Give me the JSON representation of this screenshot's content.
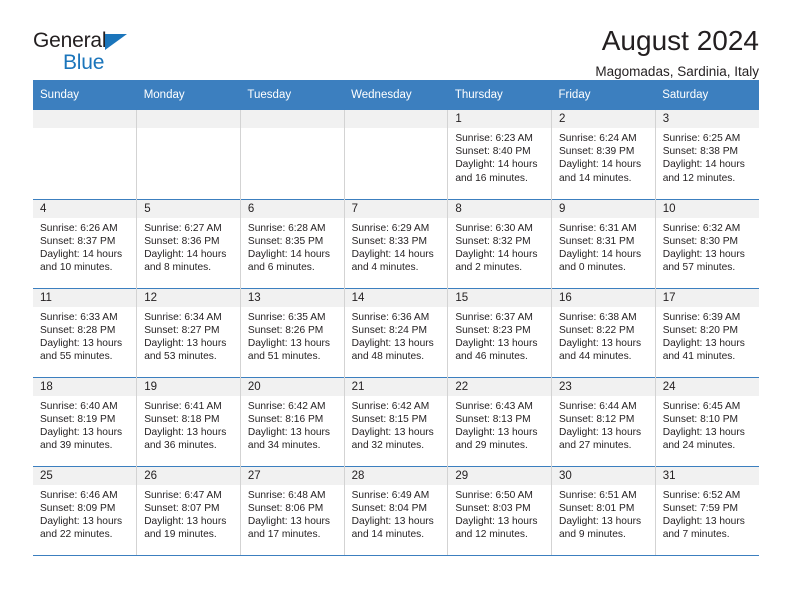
{
  "brand": {
    "name_part1": "General",
    "name_part2": "Blue",
    "triangle_color": "#1b75bb"
  },
  "header": {
    "title": "August 2024",
    "subtitle": "Magomadas, Sardinia, Italy"
  },
  "theme": {
    "header_blue": "#3c7fbf",
    "daynum_band": "#f1f1f1",
    "grid_line": "#d3d3d3",
    "text": "#231f20"
  },
  "weekday_headers": [
    "Sunday",
    "Monday",
    "Tuesday",
    "Wednesday",
    "Thursday",
    "Friday",
    "Saturday"
  ],
  "weeks": [
    [
      {
        "day": "",
        "sunrise": "",
        "sunset": "",
        "daylight_line1": "",
        "daylight_line2": ""
      },
      {
        "day": "",
        "sunrise": "",
        "sunset": "",
        "daylight_line1": "",
        "daylight_line2": ""
      },
      {
        "day": "",
        "sunrise": "",
        "sunset": "",
        "daylight_line1": "",
        "daylight_line2": ""
      },
      {
        "day": "",
        "sunrise": "",
        "sunset": "",
        "daylight_line1": "",
        "daylight_line2": ""
      },
      {
        "day": "1",
        "sunrise": "Sunrise: 6:23 AM",
        "sunset": "Sunset: 8:40 PM",
        "daylight_line1": "Daylight: 14 hours",
        "daylight_line2": "and 16 minutes."
      },
      {
        "day": "2",
        "sunrise": "Sunrise: 6:24 AM",
        "sunset": "Sunset: 8:39 PM",
        "daylight_line1": "Daylight: 14 hours",
        "daylight_line2": "and 14 minutes."
      },
      {
        "day": "3",
        "sunrise": "Sunrise: 6:25 AM",
        "sunset": "Sunset: 8:38 PM",
        "daylight_line1": "Daylight: 14 hours",
        "daylight_line2": "and 12 minutes."
      }
    ],
    [
      {
        "day": "4",
        "sunrise": "Sunrise: 6:26 AM",
        "sunset": "Sunset: 8:37 PM",
        "daylight_line1": "Daylight: 14 hours",
        "daylight_line2": "and 10 minutes."
      },
      {
        "day": "5",
        "sunrise": "Sunrise: 6:27 AM",
        "sunset": "Sunset: 8:36 PM",
        "daylight_line1": "Daylight: 14 hours",
        "daylight_line2": "and 8 minutes."
      },
      {
        "day": "6",
        "sunrise": "Sunrise: 6:28 AM",
        "sunset": "Sunset: 8:35 PM",
        "daylight_line1": "Daylight: 14 hours",
        "daylight_line2": "and 6 minutes."
      },
      {
        "day": "7",
        "sunrise": "Sunrise: 6:29 AM",
        "sunset": "Sunset: 8:33 PM",
        "daylight_line1": "Daylight: 14 hours",
        "daylight_line2": "and 4 minutes."
      },
      {
        "day": "8",
        "sunrise": "Sunrise: 6:30 AM",
        "sunset": "Sunset: 8:32 PM",
        "daylight_line1": "Daylight: 14 hours",
        "daylight_line2": "and 2 minutes."
      },
      {
        "day": "9",
        "sunrise": "Sunrise: 6:31 AM",
        "sunset": "Sunset: 8:31 PM",
        "daylight_line1": "Daylight: 14 hours",
        "daylight_line2": "and 0 minutes."
      },
      {
        "day": "10",
        "sunrise": "Sunrise: 6:32 AM",
        "sunset": "Sunset: 8:30 PM",
        "daylight_line1": "Daylight: 13 hours",
        "daylight_line2": "and 57 minutes."
      }
    ],
    [
      {
        "day": "11",
        "sunrise": "Sunrise: 6:33 AM",
        "sunset": "Sunset: 8:28 PM",
        "daylight_line1": "Daylight: 13 hours",
        "daylight_line2": "and 55 minutes."
      },
      {
        "day": "12",
        "sunrise": "Sunrise: 6:34 AM",
        "sunset": "Sunset: 8:27 PM",
        "daylight_line1": "Daylight: 13 hours",
        "daylight_line2": "and 53 minutes."
      },
      {
        "day": "13",
        "sunrise": "Sunrise: 6:35 AM",
        "sunset": "Sunset: 8:26 PM",
        "daylight_line1": "Daylight: 13 hours",
        "daylight_line2": "and 51 minutes."
      },
      {
        "day": "14",
        "sunrise": "Sunrise: 6:36 AM",
        "sunset": "Sunset: 8:24 PM",
        "daylight_line1": "Daylight: 13 hours",
        "daylight_line2": "and 48 minutes."
      },
      {
        "day": "15",
        "sunrise": "Sunrise: 6:37 AM",
        "sunset": "Sunset: 8:23 PM",
        "daylight_line1": "Daylight: 13 hours",
        "daylight_line2": "and 46 minutes."
      },
      {
        "day": "16",
        "sunrise": "Sunrise: 6:38 AM",
        "sunset": "Sunset: 8:22 PM",
        "daylight_line1": "Daylight: 13 hours",
        "daylight_line2": "and 44 minutes."
      },
      {
        "day": "17",
        "sunrise": "Sunrise: 6:39 AM",
        "sunset": "Sunset: 8:20 PM",
        "daylight_line1": "Daylight: 13 hours",
        "daylight_line2": "and 41 minutes."
      }
    ],
    [
      {
        "day": "18",
        "sunrise": "Sunrise: 6:40 AM",
        "sunset": "Sunset: 8:19 PM",
        "daylight_line1": "Daylight: 13 hours",
        "daylight_line2": "and 39 minutes."
      },
      {
        "day": "19",
        "sunrise": "Sunrise: 6:41 AM",
        "sunset": "Sunset: 8:18 PM",
        "daylight_line1": "Daylight: 13 hours",
        "daylight_line2": "and 36 minutes."
      },
      {
        "day": "20",
        "sunrise": "Sunrise: 6:42 AM",
        "sunset": "Sunset: 8:16 PM",
        "daylight_line1": "Daylight: 13 hours",
        "daylight_line2": "and 34 minutes."
      },
      {
        "day": "21",
        "sunrise": "Sunrise: 6:42 AM",
        "sunset": "Sunset: 8:15 PM",
        "daylight_line1": "Daylight: 13 hours",
        "daylight_line2": "and 32 minutes."
      },
      {
        "day": "22",
        "sunrise": "Sunrise: 6:43 AM",
        "sunset": "Sunset: 8:13 PM",
        "daylight_line1": "Daylight: 13 hours",
        "daylight_line2": "and 29 minutes."
      },
      {
        "day": "23",
        "sunrise": "Sunrise: 6:44 AM",
        "sunset": "Sunset: 8:12 PM",
        "daylight_line1": "Daylight: 13 hours",
        "daylight_line2": "and 27 minutes."
      },
      {
        "day": "24",
        "sunrise": "Sunrise: 6:45 AM",
        "sunset": "Sunset: 8:10 PM",
        "daylight_line1": "Daylight: 13 hours",
        "daylight_line2": "and 24 minutes."
      }
    ],
    [
      {
        "day": "25",
        "sunrise": "Sunrise: 6:46 AM",
        "sunset": "Sunset: 8:09 PM",
        "daylight_line1": "Daylight: 13 hours",
        "daylight_line2": "and 22 minutes."
      },
      {
        "day": "26",
        "sunrise": "Sunrise: 6:47 AM",
        "sunset": "Sunset: 8:07 PM",
        "daylight_line1": "Daylight: 13 hours",
        "daylight_line2": "and 19 minutes."
      },
      {
        "day": "27",
        "sunrise": "Sunrise: 6:48 AM",
        "sunset": "Sunset: 8:06 PM",
        "daylight_line1": "Daylight: 13 hours",
        "daylight_line2": "and 17 minutes."
      },
      {
        "day": "28",
        "sunrise": "Sunrise: 6:49 AM",
        "sunset": "Sunset: 8:04 PM",
        "daylight_line1": "Daylight: 13 hours",
        "daylight_line2": "and 14 minutes."
      },
      {
        "day": "29",
        "sunrise": "Sunrise: 6:50 AM",
        "sunset": "Sunset: 8:03 PM",
        "daylight_line1": "Daylight: 13 hours",
        "daylight_line2": "and 12 minutes."
      },
      {
        "day": "30",
        "sunrise": "Sunrise: 6:51 AM",
        "sunset": "Sunset: 8:01 PM",
        "daylight_line1": "Daylight: 13 hours",
        "daylight_line2": "and 9 minutes."
      },
      {
        "day": "31",
        "sunrise": "Sunrise: 6:52 AM",
        "sunset": "Sunset: 7:59 PM",
        "daylight_line1": "Daylight: 13 hours",
        "daylight_line2": "and 7 minutes."
      }
    ]
  ]
}
